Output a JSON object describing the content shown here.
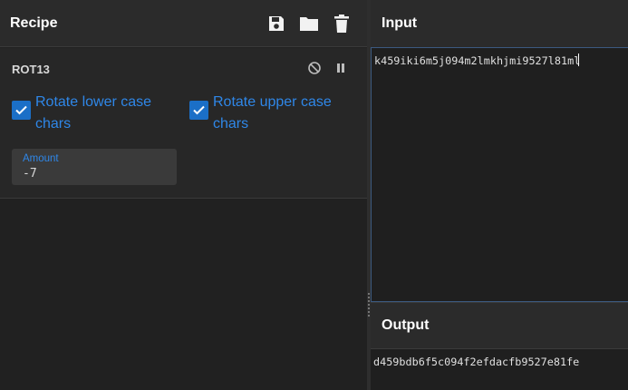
{
  "recipe": {
    "title": "Recipe",
    "icons": [
      "save-icon",
      "folder-icon",
      "trash-icon"
    ]
  },
  "operation": {
    "name": "ROT13",
    "rotate_lower": {
      "label": "Rotate lower case chars",
      "checked": true
    },
    "rotate_upper": {
      "label": "Rotate upper case chars",
      "checked": true
    },
    "amount": {
      "label": "Amount",
      "value": "-7"
    }
  },
  "input": {
    "title": "Input",
    "text": "k459iki6m5j094m2lmkhjmi9527l81ml"
  },
  "output": {
    "title": "Output",
    "text": "d459bdb6f5c094f2efdacfb9527e81fe"
  },
  "colors": {
    "accent": "#2f87e8",
    "checkbox": "#1b6fc7",
    "header_bg": "#2b2b2b",
    "panel_bg": "#212121"
  }
}
